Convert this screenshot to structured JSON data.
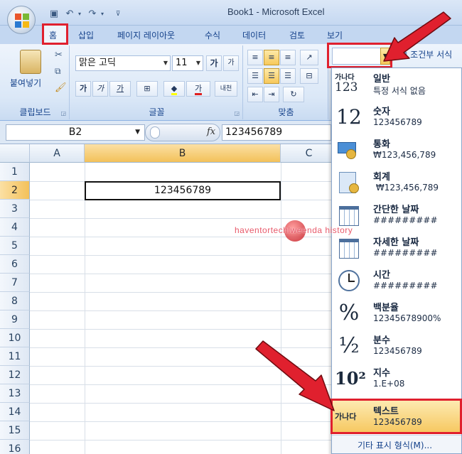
{
  "window": {
    "title": "Book1 - Microsoft Excel"
  },
  "tabs": [
    "홈",
    "삽입",
    "페이지 레이아웃",
    "수식",
    "데이터",
    "검토",
    "보기"
  ],
  "ribbon": {
    "clipboard": {
      "paste_label": "붙여넣기",
      "group_label": "클립보드"
    },
    "font": {
      "font_name": "맑은 고딕",
      "font_size": "11",
      "grow_label": "가",
      "shrink_label": "가",
      "bold": "가",
      "italic": "가",
      "underline": "가",
      "font_color_glyph": "가",
      "phonetic": "내천",
      "group_label": "글꼴"
    },
    "alignment": {
      "group_label": "맞춤"
    },
    "number": {
      "format_value": ""
    },
    "conditional_format_label": "조건부 서식",
    "accent_color": "#e0202e"
  },
  "formula_bar": {
    "name_box": "B2",
    "fx": "fx",
    "value": "123456789"
  },
  "sheet": {
    "columns": [
      "A",
      "B",
      "C"
    ],
    "rows": [
      "1",
      "2",
      "3",
      "4",
      "5",
      "6",
      "7",
      "8",
      "9",
      "10",
      "11",
      "12",
      "13",
      "14",
      "15",
      "16"
    ],
    "cell_b2": "123456789"
  },
  "watermark": "haventortechlweenda history",
  "number_formats": [
    {
      "icon": "가나다 123",
      "name": "일반",
      "sample": "특정 서식 없음"
    },
    {
      "icon": "12",
      "name": "숫자",
      "sample": "123456789"
    },
    {
      "icon": "currency-icon",
      "name": "통화",
      "sample": "₩123,456,789"
    },
    {
      "icon": "accounting-icon",
      "name": "회계",
      "sample": " ₩123,456,789"
    },
    {
      "icon": "calendar-icon",
      "name": "간단한 날짜",
      "sample": "#########"
    },
    {
      "icon": "calendar-icon",
      "name": "자세한 날짜",
      "sample": "#########"
    },
    {
      "icon": "clock-icon",
      "name": "시간",
      "sample": "#########"
    },
    {
      "icon": "%",
      "name": "백분율",
      "sample": "12345678900%"
    },
    {
      "icon": "½",
      "name": "분수",
      "sample": "123456789"
    },
    {
      "icon": "10²",
      "name": "지수",
      "sample": "1.E+08"
    },
    {
      "icon": "가나다",
      "name": "텍스트",
      "sample": "123456789"
    }
  ],
  "more_formats": "기타 표시 형식(M)..."
}
